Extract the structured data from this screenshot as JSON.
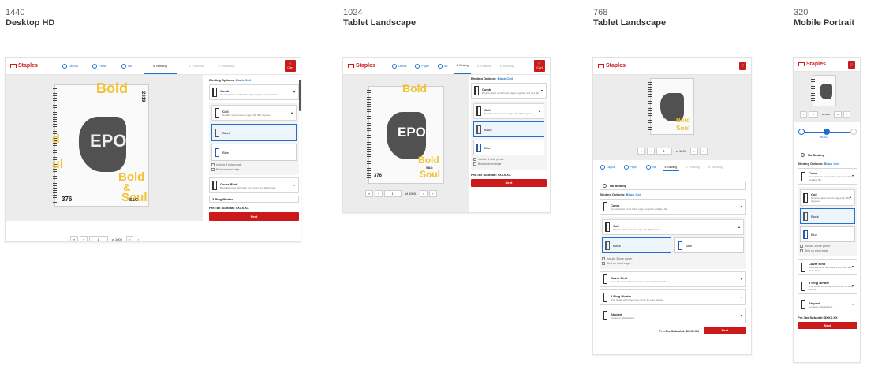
{
  "viewports": [
    {
      "number": "1440",
      "label": "Desktop HD"
    },
    {
      "number": "1024",
      "label": "Tablet Landscape"
    },
    {
      "number": "768",
      "label": "Tablet Landscape"
    },
    {
      "number": "320",
      "label": "Mobile Portrait"
    }
  ],
  "brand": "Staples",
  "cart": "Cart",
  "steps": [
    "Layout",
    "Paper",
    "Ink",
    "4. Binding",
    "5. Finishing",
    "6. Handling"
  ],
  "binding_options_label": "Binding Options:",
  "binding_selected": "Black Coil",
  "no_binding": "No Binding",
  "options": [
    {
      "title": "Comb",
      "desc": "Round plastic comb holds pages together and lays flat."
    },
    {
      "title": "Coil",
      "desc": "Durable spiral coil lets pages flip 360 degrees."
    },
    {
      "title": "Cover Bind",
      "desc": "Book-like cover with clear front cover and black back."
    },
    {
      "title": "3 Ring Binder",
      "desc": "Ring binder with three-hole punch for easy access."
    },
    {
      "title": "Stapled",
      "desc": "Corner or side stapling."
    }
  ],
  "colors": [
    "Black",
    "Blue"
  ],
  "include_punch": "Include 3 hole punch",
  "bind_short": "Bind on short edge",
  "subtotal_label": "Pre-Tax Subtotal:",
  "subtotal_value": "$XXX.XX",
  "next": "Next",
  "pager": {
    "page": "1",
    "of": "of 1000"
  },
  "cover": {
    "bold": "Bold",
    "soul": "Soul",
    "epo": "EPO",
    "year": "2019",
    "num": "376",
    "sg": "S&G",
    "and": "&"
  },
  "mobile_step": "Binding"
}
